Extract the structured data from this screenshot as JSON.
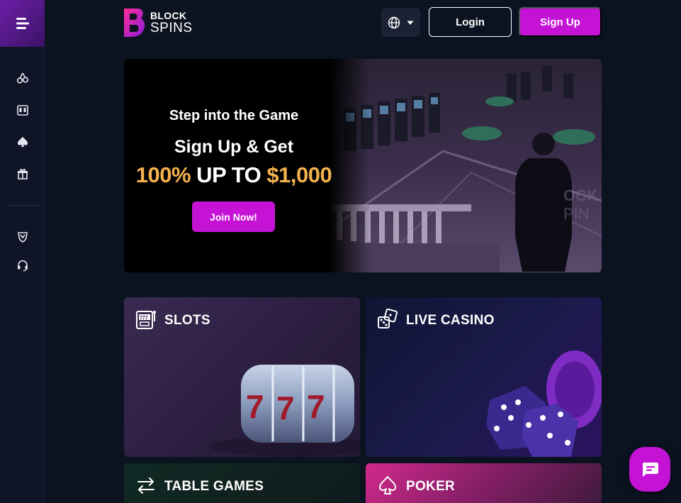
{
  "header": {
    "logo_line1": "BLOCK",
    "logo_line2": "SPINS",
    "login_label": "Login",
    "signup_label": "Sign Up"
  },
  "sidebar": {
    "items": [
      {
        "icon": "cherries-icon"
      },
      {
        "icon": "slot-machine-icon"
      },
      {
        "icon": "spade-icon"
      },
      {
        "icon": "gift-icon"
      },
      {
        "icon": "vip-shield-icon"
      },
      {
        "icon": "headset-icon"
      }
    ]
  },
  "hero": {
    "eyebrow": "Step into the Game",
    "line2": "Sign Up & Get",
    "line3_highlight1": "100%",
    "line3_middle": " UP TO ",
    "line3_highlight2": "$1,000",
    "cta_label": "Join Now!"
  },
  "categories": [
    {
      "title": "SLOTS"
    },
    {
      "title": "LIVE CASINO"
    },
    {
      "title": "TABLE GAMES"
    },
    {
      "title": "POKER"
    }
  ],
  "colors": {
    "accent": "#c513d6",
    "gold": "#f4b24e",
    "background": "#0b1220"
  }
}
